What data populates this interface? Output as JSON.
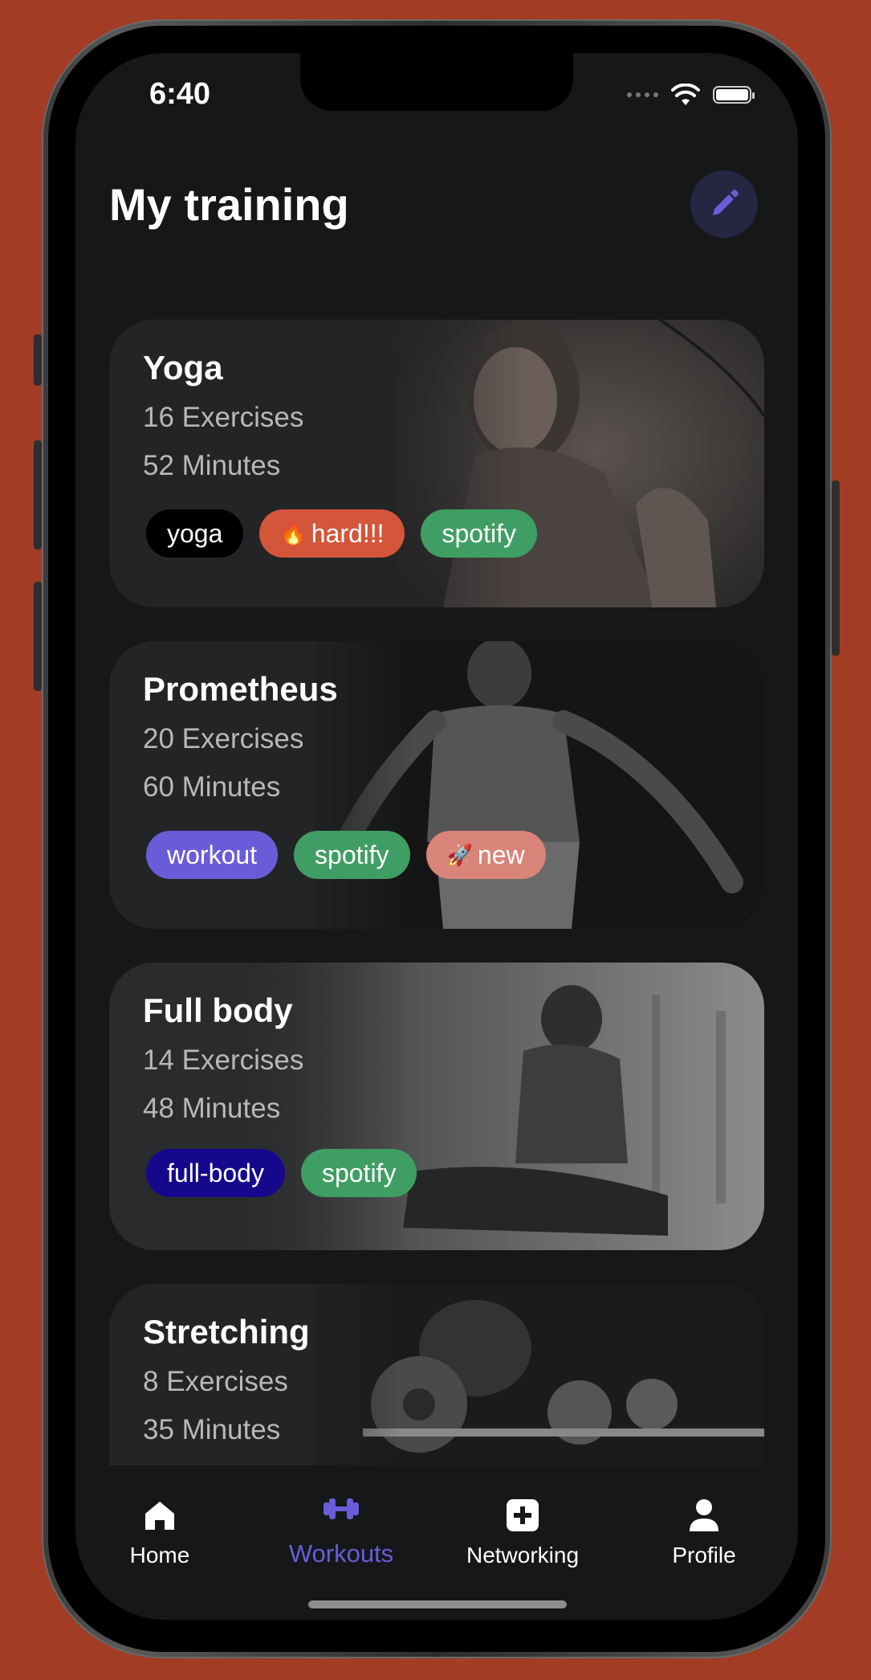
{
  "status_bar": {
    "time": "6:40"
  },
  "header": {
    "title": "My training",
    "edit_icon": "pencil-icon"
  },
  "colors": {
    "accent": "#6a5cd9",
    "background": "#161719",
    "card": "#232426",
    "outer": "#a33c24"
  },
  "workouts": [
    {
      "title": "Yoga",
      "exercises": "16 Exercises",
      "minutes": "52 Minutes",
      "tags": [
        {
          "label": "yoga",
          "color": "#000000",
          "emoji": ""
        },
        {
          "label": "hard!!!",
          "color": "#d3553a",
          "emoji": "🔥"
        },
        {
          "label": "spotify",
          "color": "#3f9e63",
          "emoji": ""
        }
      ]
    },
    {
      "title": "Prometheus",
      "exercises": "20 Exercises",
      "minutes": "60 Minutes",
      "tags": [
        {
          "label": "workout",
          "color": "#6a5cd9",
          "emoji": ""
        },
        {
          "label": "spotify",
          "color": "#3f9e63",
          "emoji": ""
        },
        {
          "label": "new",
          "color": "#d98478",
          "emoji": "🚀"
        }
      ]
    },
    {
      "title": "Full body",
      "exercises": "14 Exercises",
      "minutes": "48 Minutes",
      "tags": [
        {
          "label": "full-body",
          "color": "#16088c",
          "emoji": ""
        },
        {
          "label": "spotify",
          "color": "#3f9e63",
          "emoji": ""
        }
      ]
    },
    {
      "title": "Stretching",
      "exercises": "8 Exercises",
      "minutes": "35 Minutes",
      "tags": []
    }
  ],
  "tabbar": {
    "active": "Workouts",
    "tabs": [
      {
        "label": "Home",
        "icon": "house-icon"
      },
      {
        "label": "Workouts",
        "icon": "dumbbell-icon"
      },
      {
        "label": "Networking",
        "icon": "plus-square-icon"
      },
      {
        "label": "Profile",
        "icon": "person-icon"
      }
    ]
  }
}
